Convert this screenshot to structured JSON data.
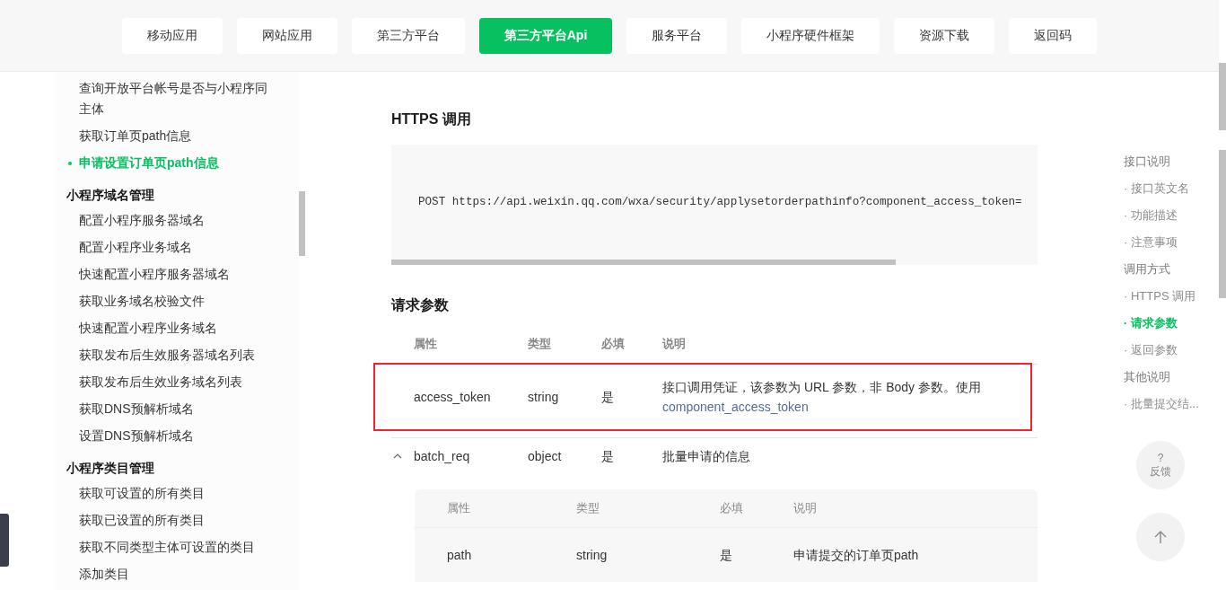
{
  "nav": {
    "tabs": [
      {
        "label": "移动应用",
        "selected": false
      },
      {
        "label": "网站应用",
        "selected": false
      },
      {
        "label": "第三方平台",
        "selected": false
      },
      {
        "label": "第三方平台Api",
        "selected": true
      },
      {
        "label": "服务平台",
        "selected": false
      },
      {
        "label": "小程序硬件框架",
        "selected": false
      },
      {
        "label": "资源下载",
        "selected": false
      },
      {
        "label": "返回码",
        "selected": false
      }
    ]
  },
  "sidebar": {
    "groups": [
      {
        "items": [
          {
            "label": "查询开放平台帐号是否与小程序同主体",
            "selected": false
          },
          {
            "label": "获取订单页path信息",
            "selected": false
          },
          {
            "label": "申请设置订单页path信息",
            "selected": true
          }
        ]
      },
      {
        "title": "小程序域名管理",
        "items": [
          {
            "label": "配置小程序服务器域名",
            "selected": false
          },
          {
            "label": "配置小程序业务域名",
            "selected": false
          },
          {
            "label": "快速配置小程序服务器域名",
            "selected": false
          },
          {
            "label": "获取业务域名校验文件",
            "selected": false
          },
          {
            "label": "快速配置小程序业务域名",
            "selected": false
          },
          {
            "label": "获取发布后生效服务器域名列表",
            "selected": false
          },
          {
            "label": "获取发布后生效业务域名列表",
            "selected": false
          },
          {
            "label": "获取DNS预解析域名",
            "selected": false
          },
          {
            "label": "设置DNS预解析域名",
            "selected": false
          }
        ]
      },
      {
        "title": "小程序类目管理",
        "items": [
          {
            "label": "获取可设置的所有类目",
            "selected": false
          },
          {
            "label": "获取已设置的所有类目",
            "selected": false
          },
          {
            "label": "获取不同类型主体可设置的类目",
            "selected": false
          },
          {
            "label": "添加类目",
            "selected": false
          }
        ]
      }
    ]
  },
  "content": {
    "https_heading": "HTTPS 调用",
    "code": "POST https://api.weixin.qq.com/wxa/security/applysetorderpathinfo?component_access_token=",
    "params_heading": "请求参数",
    "table": {
      "columns": [
        "属性",
        "类型",
        "必填",
        "说明"
      ],
      "rows": [
        {
          "name": "access_token",
          "type": "string",
          "required": "是",
          "description": "接口调用凭证，该参数为 URL 参数，非 Body 参数。使用",
          "link": "component_access_token",
          "highlighted": true
        },
        {
          "name": "batch_req",
          "type": "object",
          "required": "是",
          "description": "批量申请的信息",
          "expanded": true,
          "highlighted": false,
          "sub_table": {
            "columns": [
              "属性",
              "类型",
              "必填",
              "说明"
            ],
            "rows": [
              {
                "name": "path",
                "type": "string",
                "required": "是",
                "description": "申请提交的订单页path"
              }
            ]
          }
        }
      ]
    }
  },
  "toc": {
    "items": [
      {
        "label": "接口说明",
        "kind": "section",
        "selected": false
      },
      {
        "label": "· 接口英文名",
        "kind": "sub",
        "selected": false
      },
      {
        "label": "· 功能描述",
        "kind": "sub",
        "selected": false
      },
      {
        "label": "· 注意事项",
        "kind": "sub",
        "selected": false
      },
      {
        "label": "调用方式",
        "kind": "section",
        "selected": false
      },
      {
        "label": "· HTTPS 调用",
        "kind": "sub",
        "selected": false
      },
      {
        "label": "· 请求参数",
        "kind": "sub",
        "selected": true
      },
      {
        "label": "· 返回参数",
        "kind": "sub",
        "selected": false
      },
      {
        "label": "其他说明",
        "kind": "section",
        "selected": false
      },
      {
        "label": "· 批量提交结...",
        "kind": "sub",
        "selected": false
      }
    ]
  },
  "feedback": {
    "icon": "?",
    "label": "反馈"
  }
}
